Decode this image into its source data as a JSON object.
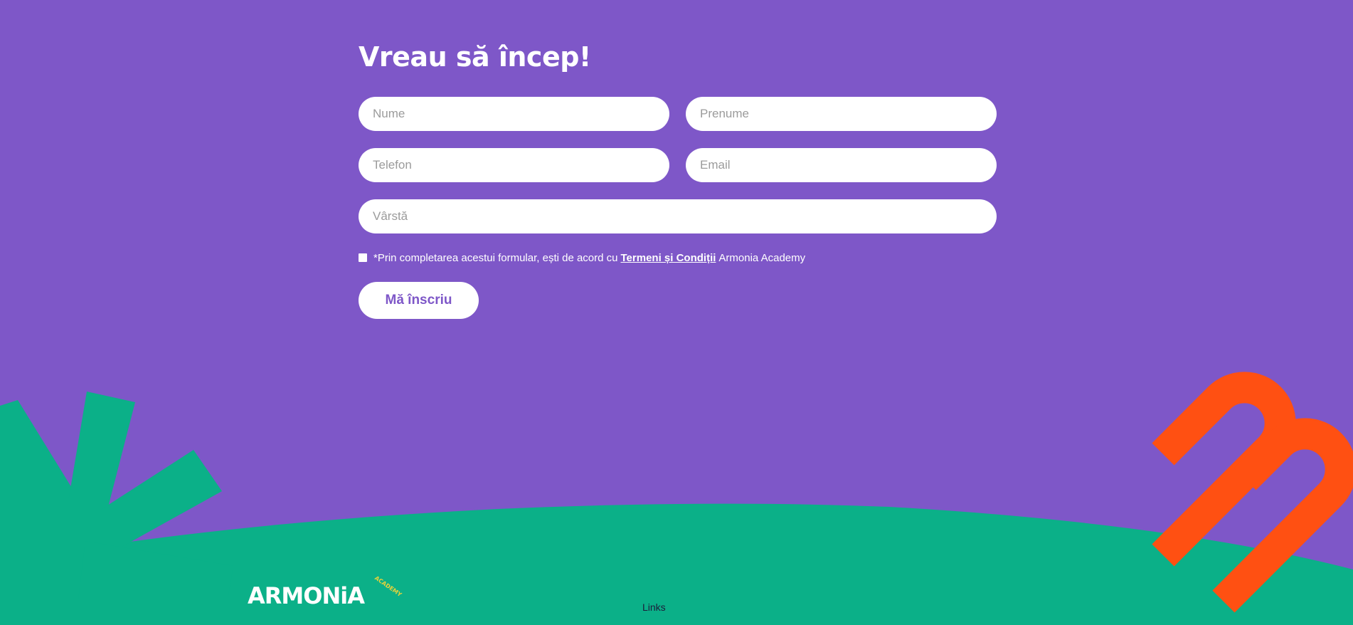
{
  "form": {
    "title": "Vreau să încep!",
    "fields": {
      "nume": {
        "placeholder": "Nume",
        "value": ""
      },
      "prenume": {
        "placeholder": "Prenume",
        "value": ""
      },
      "telefon": {
        "placeholder": "Telefon",
        "value": ""
      },
      "email": {
        "placeholder": "Email",
        "value": ""
      },
      "varsta": {
        "placeholder": "Vârstă",
        "value": ""
      }
    },
    "consent": {
      "checked": false,
      "prefix": "*Prin completarea acestui formular, ești de acord cu",
      "link_label": "Termeni și Condiții",
      "suffix": "Armonia Academy"
    },
    "submit_label": "Mă înscriu"
  },
  "footer": {
    "logo_text": "ARMONiA",
    "logo_tagline": "ACADEMY",
    "links_label": "Links"
  },
  "colors": {
    "background": "#7e57c8",
    "ground": "#0bb088",
    "orange_shape": "#ff5012",
    "accent_text": "#7e57c8",
    "logo_tagline": "#e8d23a"
  }
}
